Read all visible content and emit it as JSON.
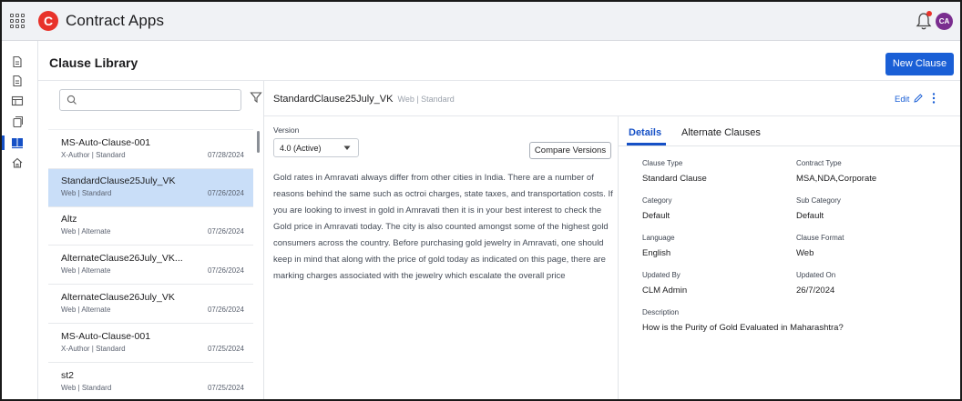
{
  "app": {
    "title": "Contract Apps",
    "logo_letter": "C",
    "user_initials": "CA",
    "accent": "#1a5fd6",
    "brand": "#e8322a"
  },
  "page": {
    "title": "Clause Library",
    "new_button": "New Clause"
  },
  "list": {
    "search": {
      "placeholder": "",
      "value": ""
    },
    "items": [
      {
        "title": "MS-Auto-Clause-001",
        "sub": "X-Author | Standard",
        "date": "07/28/2024",
        "selected": false
      },
      {
        "title": "StandardClause25July_VK",
        "sub": "Web | Standard",
        "date": "07/26/2024",
        "selected": true
      },
      {
        "title": "Altz",
        "sub": "Web | Alternate",
        "date": "07/26/2024",
        "selected": false
      },
      {
        "title": "AlternateClause26July_VK...",
        "sub": "Web | Alternate",
        "date": "07/26/2024",
        "selected": false
      },
      {
        "title": "AlternateClause26July_VK",
        "sub": "Web | Alternate",
        "date": "07/26/2024",
        "selected": false
      },
      {
        "title": "MS-Auto-Clause-001",
        "sub": "X-Author | Standard",
        "date": "07/25/2024",
        "selected": false
      },
      {
        "title": "st2",
        "sub": "Web | Standard",
        "date": "07/25/2024",
        "selected": false
      }
    ]
  },
  "detail": {
    "title": "StandardClause25July_VK",
    "meta": "Web | Standard",
    "edit": "Edit",
    "version_label": "Version",
    "version_value": "4.0 (Active)",
    "compare_button": "Compare Versions",
    "body": "Gold rates in Amravati always differ from other cities in India. There are a number of reasons behind the same such as octroi charges, state taxes, and transportation costs. If you are looking to invest in gold in Amravati then it is in your best interest to check the Gold price in Amravati today. The city is also counted amongst some of the highest gold consumers across the country. Before purchasing gold jewelry in Amravati, one should keep in mind that along with the price of gold today as indicated on this page, there are marking charges associated with the jewelry which escalate the overall price"
  },
  "details_panel": {
    "tabs": [
      "Details",
      "Alternate Clauses"
    ],
    "fields": {
      "clause_type": {
        "label": "Clause Type",
        "value": "Standard Clause"
      },
      "contract_type": {
        "label": "Contract Type",
        "value": "MSA,NDA,Corporate"
      },
      "category": {
        "label": "Category",
        "value": "Default"
      },
      "sub_category": {
        "label": "Sub Category",
        "value": "Default"
      },
      "language": {
        "label": "Language",
        "value": "English"
      },
      "clause_format": {
        "label": "Clause Format",
        "value": "Web"
      },
      "updated_by": {
        "label": "Updated By",
        "value": "CLM Admin"
      },
      "updated_on": {
        "label": "Updated On",
        "value": "26/7/2024"
      },
      "description": {
        "label": "Description",
        "value": "How is the Purity of Gold Evaluated in Maharashtra?"
      }
    }
  },
  "icons": {
    "app_launcher": "grid-icon",
    "rail": [
      "document-icon",
      "document-icon",
      "table-icon",
      "copy-icon",
      "library-icon",
      "home-icon"
    ],
    "notifications": "bell-icon",
    "search": "search-icon",
    "filter": "filter-icon",
    "edit": "pencil-icon",
    "more": "kebab-icon"
  }
}
